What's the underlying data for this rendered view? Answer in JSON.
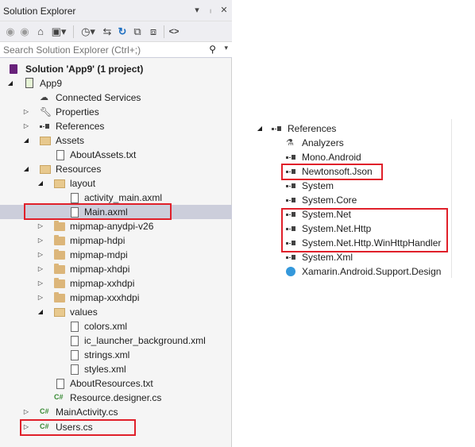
{
  "solution_explorer": {
    "title": "Solution Explorer",
    "title_buttons": [
      "dropdown-icon",
      "pin-icon",
      "close-icon"
    ],
    "toolbar_icons": [
      "back-icon",
      "forward-icon",
      "home-icon",
      "switch-views-icon",
      "history-icon",
      "sync-icon",
      "refresh-icon",
      "collapse-all-icon",
      "show-all-files-icon",
      "preview-icon"
    ],
    "search": {
      "placeholder": "Search Solution Explorer (Ctrl+;)",
      "value": ""
    },
    "tree": [
      {
        "label": "Solution 'App9' (1 project)",
        "bold": true,
        "icon": "solution-icon",
        "expander": ""
      },
      {
        "label": "App9",
        "icon": "android-project-icon",
        "expander": "expanded"
      },
      {
        "label": "Connected Services",
        "icon": "connected-services-icon",
        "expander": ""
      },
      {
        "label": "Properties",
        "icon": "wrench-icon",
        "expander": "collapsed"
      },
      {
        "label": "References",
        "icon": "references-icon",
        "expander": "collapsed"
      },
      {
        "label": "Assets",
        "icon": "folder-open-icon",
        "expander": "expanded"
      },
      {
        "label": "AboutAssets.txt",
        "icon": "text-file-icon",
        "expander": ""
      },
      {
        "label": "Resources",
        "icon": "folder-open-icon",
        "expander": "expanded"
      },
      {
        "label": "layout",
        "icon": "folder-open-icon",
        "expander": "expanded"
      },
      {
        "label": "activity_main.axml",
        "icon": "file-icon",
        "expander": ""
      },
      {
        "label": "Main.axml",
        "icon": "file-icon",
        "expander": "",
        "selected": true
      },
      {
        "label": "mipmap-anydpi-v26",
        "icon": "folder-icon",
        "expander": "collapsed"
      },
      {
        "label": "mipmap-hdpi",
        "icon": "folder-icon",
        "expander": "collapsed"
      },
      {
        "label": "mipmap-mdpi",
        "icon": "folder-icon",
        "expander": "collapsed"
      },
      {
        "label": "mipmap-xhdpi",
        "icon": "folder-icon",
        "expander": "collapsed"
      },
      {
        "label": "mipmap-xxhdpi",
        "icon": "folder-icon",
        "expander": "collapsed"
      },
      {
        "label": "mipmap-xxxhdpi",
        "icon": "folder-icon",
        "expander": "collapsed"
      },
      {
        "label": "values",
        "icon": "folder-open-icon",
        "expander": "expanded"
      },
      {
        "label": "colors.xml",
        "icon": "file-icon",
        "expander": ""
      },
      {
        "label": "ic_launcher_background.xml",
        "icon": "file-icon",
        "expander": ""
      },
      {
        "label": "strings.xml",
        "icon": "file-icon",
        "expander": ""
      },
      {
        "label": "styles.xml",
        "icon": "file-icon",
        "expander": ""
      },
      {
        "label": "AboutResources.txt",
        "icon": "text-file-icon",
        "expander": ""
      },
      {
        "label": "Resource.designer.cs",
        "icon": "csharp-file-icon",
        "expander": ""
      },
      {
        "label": "MainActivity.cs",
        "icon": "csharp-file-icon",
        "expander": "collapsed"
      },
      {
        "label": "Users.cs",
        "icon": "csharp-file-icon",
        "expander": "collapsed"
      }
    ]
  },
  "references_panel": {
    "header": "References",
    "items": [
      {
        "label": "Analyzers",
        "icon": "analyzers-icon"
      },
      {
        "label": "Mono.Android",
        "icon": "references-icon"
      },
      {
        "label": "Newtonsoft.Json",
        "icon": "references-icon"
      },
      {
        "label": "System",
        "icon": "references-icon"
      },
      {
        "label": "System.Core",
        "icon": "references-icon"
      },
      {
        "label": "System.Net",
        "icon": "references-icon"
      },
      {
        "label": "System.Net.Http",
        "icon": "references-icon"
      },
      {
        "label": "System.Net.Http.WinHttpHandler",
        "icon": "references-icon"
      },
      {
        "label": "System.Xml",
        "icon": "references-icon"
      },
      {
        "label": "Xamarin.Android.Support.Design",
        "icon": "xamarin-icon"
      }
    ]
  },
  "colors": {
    "highlight_box": "#e0202a",
    "selection": "#cccedb",
    "folder": "#dcb67a",
    "csharp": "#388a34"
  }
}
